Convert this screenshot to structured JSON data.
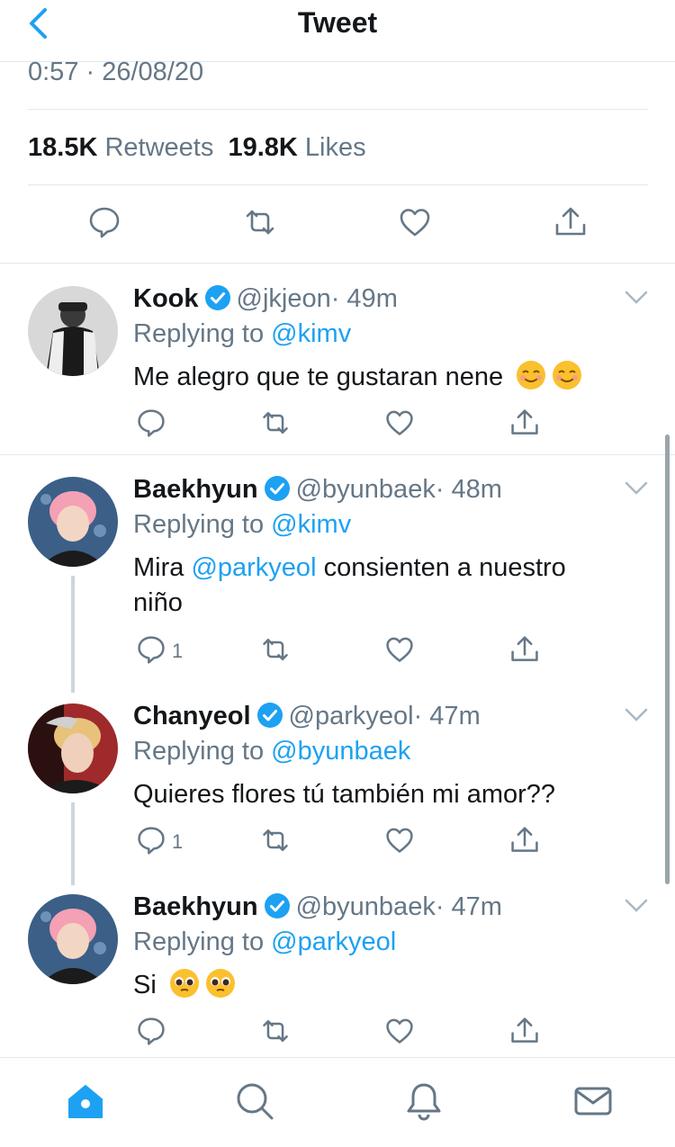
{
  "header": {
    "title": "Tweet"
  },
  "tweet": {
    "timestamp": "0:57 · 26/08/20",
    "retweets_count": "18.5K",
    "retweets_label": "Retweets",
    "likes_count": "19.8K",
    "likes_label": "Likes"
  },
  "replies": [
    {
      "name": "Kook",
      "handle": "@jkjeon",
      "time": "· 49m",
      "replying_prefix": "Replying to",
      "replying_to": "@kimv",
      "text": "Me alegro que te gustaran nene"
    },
    {
      "name": "Baekhyun",
      "handle": "@byunbaek",
      "time": "· 48m",
      "replying_prefix": "Replying to",
      "replying_to": "@kimv",
      "text_prefix": "Mira ",
      "text_mention": "@parkyeol",
      "text_suffix": " consienten a nuestro niño",
      "reply_count": "1"
    },
    {
      "name": "Chanyeol",
      "handle": "@parkyeol",
      "time": "· 47m",
      "replying_prefix": "Replying to",
      "replying_to": "@byunbaek",
      "text": "Quieres flores tú también mi amor??",
      "reply_count": "1"
    },
    {
      "name": "Baekhyun",
      "handle": "@byunbaek",
      "time": "· 47m",
      "replying_prefix": "Replying to",
      "replying_to": "@parkyeol",
      "text": "Si"
    }
  ],
  "tabs": [
    "home-icon",
    "search-icon",
    "notifications-icon",
    "messages-icon"
  ],
  "colors": {
    "accent": "#1da1f2",
    "text": "#14171a",
    "muted": "#657786",
    "divider": "#e1e8ed"
  }
}
